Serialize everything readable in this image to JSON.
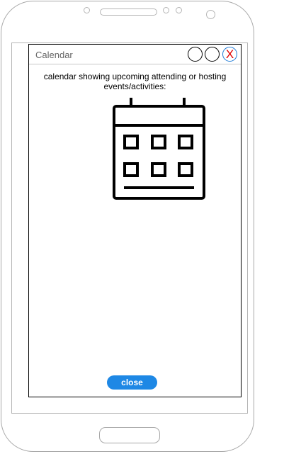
{
  "window": {
    "title": "Calendar",
    "description": "calendar showing upcoming attending or hosting events/activities:",
    "close_x_label": "X",
    "close_button_label": "close"
  },
  "icons": {
    "calendar": "calendar-icon",
    "minimize": "circle-button",
    "maximize": "circle-button",
    "close": "close-x-icon"
  },
  "colors": {
    "close_button": "#1e88e5",
    "close_x": "#e00000"
  }
}
